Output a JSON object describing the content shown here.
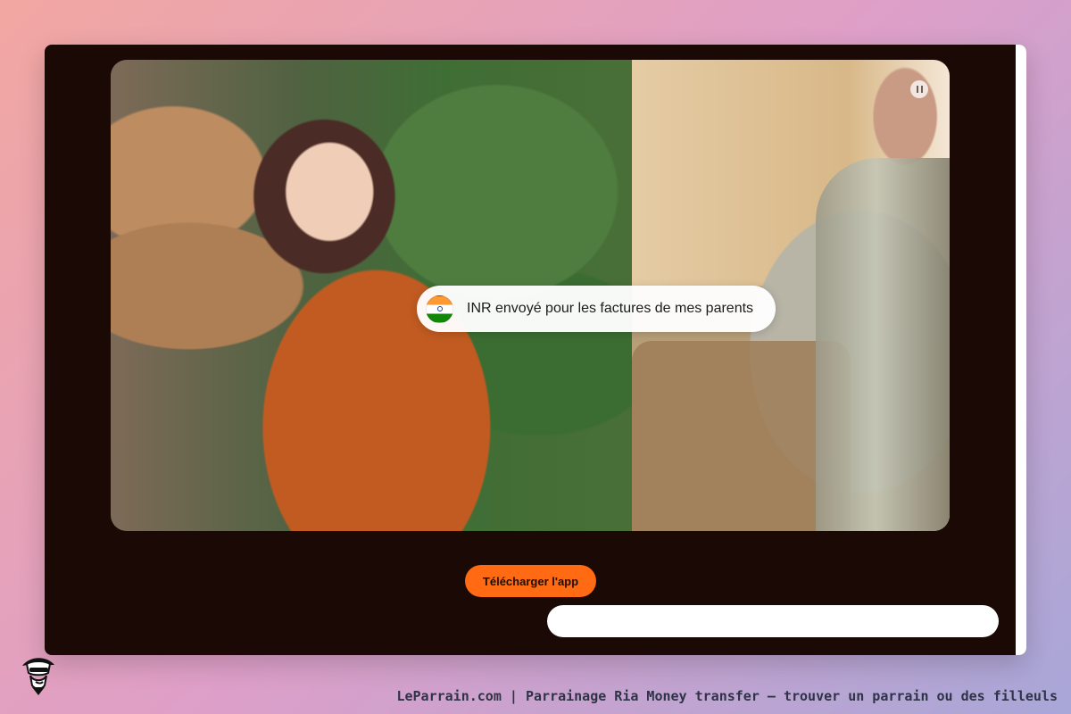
{
  "hero": {
    "badge_text": "INR envoyé pour les factures de mes parents"
  },
  "actions": {
    "download_label": "Télécharger l'app"
  },
  "footer": {
    "caption": "LeParrain.com | Parrainage Ria Money transfer — trouver un parrain ou des filleuls"
  },
  "icons": {
    "flag": "india-flag-icon",
    "pause": "pause-icon",
    "mascot": "mascot-icon"
  },
  "colors": {
    "primary_orange": "#ff6a13",
    "dark_background": "#1b0905",
    "badge_background": "#ffffff"
  }
}
